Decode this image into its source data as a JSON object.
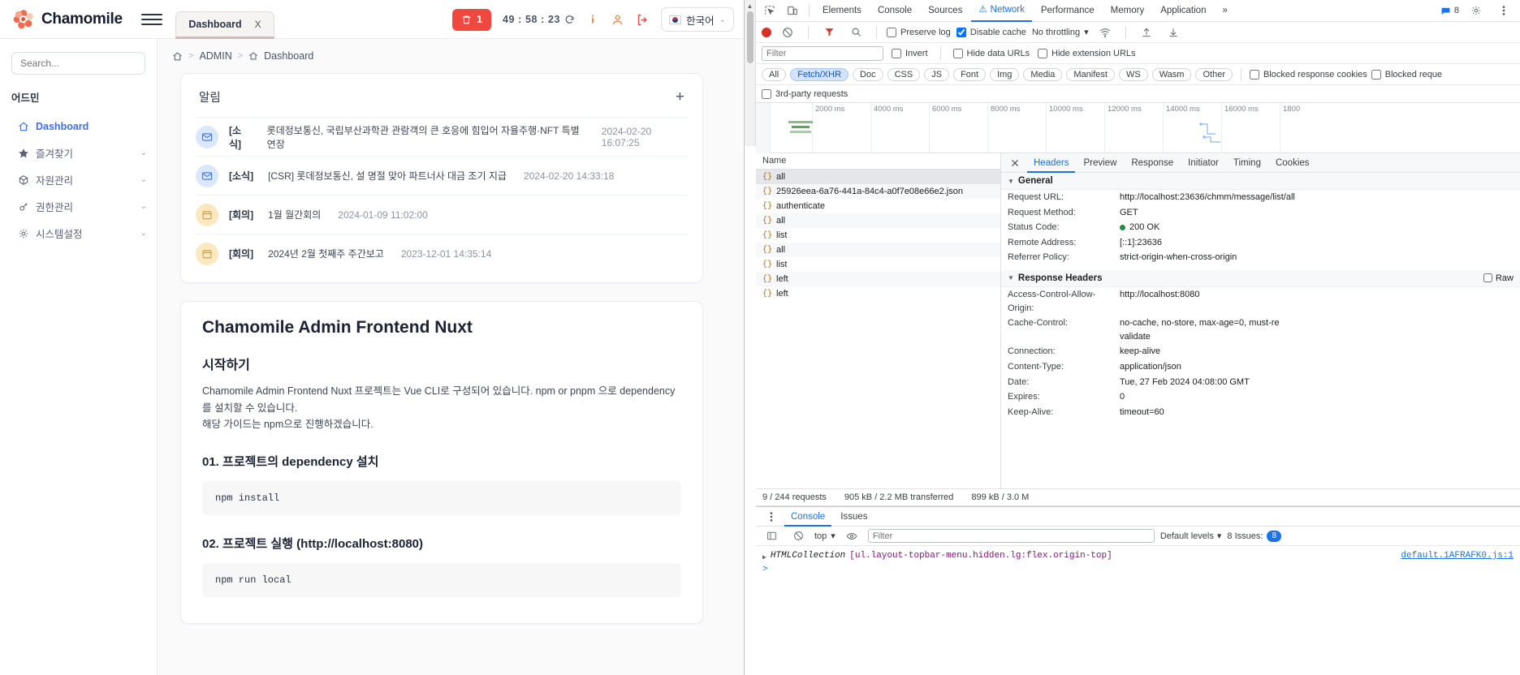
{
  "webapp": {
    "brand": "Chamomile",
    "tab": {
      "label": "Dashboard",
      "close": "X"
    },
    "top_actions": {
      "trash_count": "1",
      "timer": "49 : 58 : 23",
      "info_label": "i",
      "language": "한국어"
    },
    "sidebar": {
      "search_placeholder": "Search...",
      "group_title": "어드민",
      "items": [
        {
          "label": "Dashboard",
          "icon": "home-icon",
          "active": true,
          "expandable": false
        },
        {
          "label": "즐겨찾기",
          "icon": "star-icon",
          "active": false,
          "expandable": true
        },
        {
          "label": "자원관리",
          "icon": "box-icon",
          "active": false,
          "expandable": true
        },
        {
          "label": "권한관리",
          "icon": "key-icon",
          "active": false,
          "expandable": true
        },
        {
          "label": "시스템설정",
          "icon": "gear-icon",
          "active": false,
          "expandable": true
        }
      ]
    },
    "breadcrumb": {
      "home": "⌂",
      "sep": ">",
      "admin": "ADMIN",
      "current": "Dashboard"
    },
    "notice_card": {
      "title": "알림",
      "add_label": "+",
      "items": [
        {
          "icon": "mail-icon",
          "tag": "[소식]",
          "text": "롯데정보통신, 국립부산과학관 관람객의 큰 호응에 힘입어 자율주행·NFT 특별 연장",
          "date": "2024-02-20 16:07:25"
        },
        {
          "icon": "mail-icon",
          "tag": "[소식]",
          "text": "[CSR] 롯데정보통신, 설 명절 맞아 파트너사 대금 조기 지급",
          "date": "2024-02-20 14:33:18"
        },
        {
          "icon": "calendar-icon",
          "tag": "[회의]",
          "text": "1월 월간회의",
          "date": "2024-01-09 11:02:00"
        },
        {
          "icon": "calendar-icon",
          "tag": "[회의]",
          "text": "2024년 2월 첫째주 주간보고",
          "date": "2023-12-01 14:35:14"
        }
      ]
    },
    "readme": {
      "h1": "Chamomile Admin Frontend Nuxt",
      "h2": "시작하기",
      "p1": "Chamomile Admin Frontend Nuxt 프로젝트는 Vue CLI로 구성되어 있습니다. npm or pnpm 으로 dependency를 설치할 수 있습니다.",
      "p2": "해당 가이드는 npm으로 진행하겠습니다.",
      "s1_title": "01. 프로젝트의 dependency 설치",
      "s1_code": "npm install",
      "s2_title": "02. 프로젝트 실행 (http://localhost:8080)",
      "s2_code": "npm run local"
    }
  },
  "devtools": {
    "panel_tabs": [
      {
        "label": "Elements",
        "active": false
      },
      {
        "label": "Console",
        "active": false
      },
      {
        "label": "Sources",
        "active": false
      },
      {
        "label": "Network",
        "active": true,
        "warning": true
      },
      {
        "label": "Performance",
        "active": false
      },
      {
        "label": "Memory",
        "active": false
      },
      {
        "label": "Application",
        "active": false
      }
    ],
    "overflow_label": "»",
    "message_count": "8",
    "toolbar": {
      "preserve_log": {
        "label": "Preserve log",
        "checked": false
      },
      "disable_cache": {
        "label": "Disable cache",
        "checked": true
      },
      "throttling": "No throttling"
    },
    "filterbar": {
      "filter_placeholder": "Filter",
      "invert": {
        "label": "Invert",
        "checked": false
      },
      "hide_data_urls": {
        "label": "Hide data URLs",
        "checked": false
      },
      "hide_extension_urls": {
        "label": "Hide extension URLs",
        "checked": false
      }
    },
    "types": [
      "All",
      "Fetch/XHR",
      "Doc",
      "CSS",
      "JS",
      "Font",
      "Img",
      "Media",
      "Manifest",
      "WS",
      "Wasm",
      "Other"
    ],
    "active_type": "Fetch/XHR",
    "blocked_response_cookies": {
      "label": "Blocked response cookies",
      "checked": false
    },
    "blocked_requests": {
      "label": "Blocked reque",
      "checked": false
    },
    "third_party": {
      "label": "3rd-party requests",
      "checked": false
    },
    "timeline_ticks": [
      "2000 ms",
      "4000 ms",
      "6000 ms",
      "8000 ms",
      "10000 ms",
      "12000 ms",
      "14000 ms",
      "16000 ms",
      "1800"
    ],
    "requests_header": "Name",
    "requests": [
      {
        "name": "all",
        "selected": true
      },
      {
        "name": "25926eea-6a76-441a-84c4-a0f7e08e66e2.json",
        "selected": false
      },
      {
        "name": "authenticate",
        "selected": false
      },
      {
        "name": "all",
        "selected": false
      },
      {
        "name": "list",
        "selected": false
      },
      {
        "name": "all",
        "selected": false
      },
      {
        "name": "list",
        "selected": false
      },
      {
        "name": "left",
        "selected": false
      },
      {
        "name": "left",
        "selected": false
      }
    ],
    "detail_tabs": [
      {
        "label": "Headers",
        "active": true
      },
      {
        "label": "Preview",
        "active": false
      },
      {
        "label": "Response",
        "active": false
      },
      {
        "label": "Initiator",
        "active": false
      },
      {
        "label": "Timing",
        "active": false
      },
      {
        "label": "Cookies",
        "active": false
      }
    ],
    "general": {
      "section_title": "General",
      "rows": [
        {
          "k": "Request URL:",
          "v": "http://localhost:23636/chmm/message/list/all"
        },
        {
          "k": "Request Method:",
          "v": "GET"
        },
        {
          "k": "Status Code:",
          "v": "200 OK",
          "status": true
        },
        {
          "k": "Remote Address:",
          "v": "[::1]:23636"
        },
        {
          "k": "Referrer Policy:",
          "v": "strict-origin-when-cross-origin"
        }
      ]
    },
    "response_headers": {
      "section_title": "Response Headers",
      "raw_label": "Raw",
      "rows": [
        {
          "k": "Access-Control-Allow-Origin:",
          "v": "http://localhost:8080"
        },
        {
          "k": "Cache-Control:",
          "v": "no-cache, no-store, max-age=0, must-revalidate"
        },
        {
          "k": "Connection:",
          "v": "keep-alive"
        },
        {
          "k": "Content-Type:",
          "v": "application/json"
        },
        {
          "k": "Date:",
          "v": "Tue, 27 Feb 2024 04:08:00 GMT"
        },
        {
          "k": "Expires:",
          "v": "0"
        },
        {
          "k": "Keep-Alive:",
          "v": "timeout=60"
        }
      ]
    },
    "summary": {
      "requests": "9 / 244 requests",
      "transferred": "905 kB / 2.2 MB transferred",
      "resources": "899 kB / 3.0 M"
    },
    "drawer": {
      "tabs": [
        {
          "label": "Console",
          "active": true
        },
        {
          "label": "Issues",
          "active": false
        }
      ],
      "context": "top",
      "filter_placeholder": "Filter",
      "levels": "Default levels",
      "issues": "8 Issues:",
      "issues_count": "8",
      "log": {
        "type": "HTMLCollection",
        "value": "[ul.layout-topbar-menu.hidden.lg:flex.origin-top]",
        "source": "default.1AFRAFK0.js:1"
      },
      "prompt": ">"
    }
  }
}
